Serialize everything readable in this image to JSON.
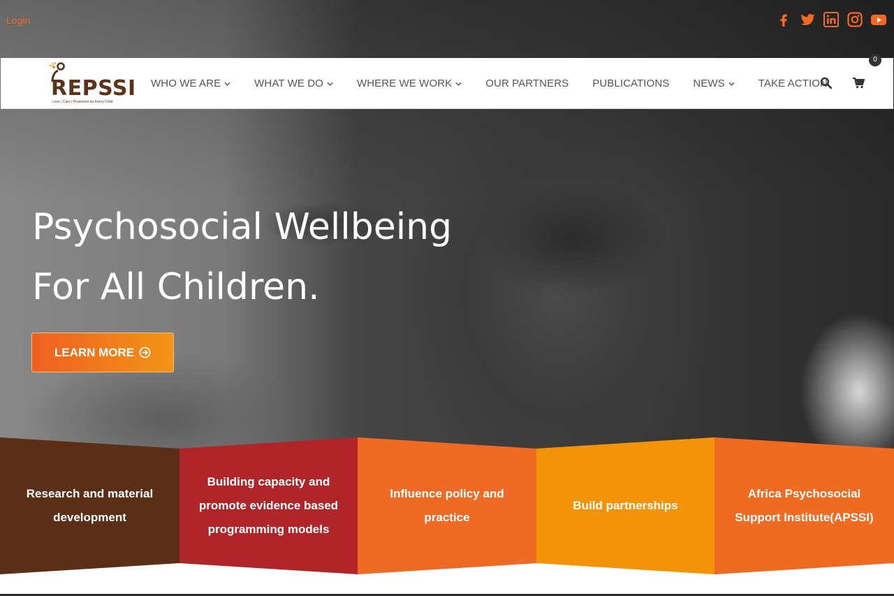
{
  "topbar": {
    "login_label": "Login",
    "socials": [
      "facebook-icon",
      "twitter-icon",
      "linkedin-icon",
      "instagram-icon",
      "youtube-icon"
    ]
  },
  "brand": {
    "name": "REPSSI",
    "tagline": "Love | Care | Protection for Every Child"
  },
  "nav": {
    "items": [
      {
        "label": "WHO WE ARE",
        "dropdown": true
      },
      {
        "label": "WHAT WE DO",
        "dropdown": true
      },
      {
        "label": "WHERE WE WORK",
        "dropdown": true
      },
      {
        "label": "OUR PARTNERS",
        "dropdown": false
      },
      {
        "label": "PUBLICATIONS",
        "dropdown": false
      },
      {
        "label": "NEWS",
        "dropdown": true
      },
      {
        "label": "TAKE ACTION",
        "dropdown": false
      }
    ],
    "cart_count": "0"
  },
  "hero": {
    "line1": "Psychosocial Wellbeing",
    "line2": "For All Children.",
    "cta_label": "LEARN MORE"
  },
  "pillars": [
    {
      "line1": "Research and material",
      "line2": "development",
      "line3": "",
      "color": "#5b2f17"
    },
    {
      "line1": "Building capacity and",
      "line2": "promote evidence based",
      "line3": "programming models",
      "color": "#b0252a"
    },
    {
      "line1": "Influence policy and",
      "line2": "practice",
      "line3": "",
      "color": "#ef6a25"
    },
    {
      "line1": "Build partnerships",
      "line2": "",
      "line3": "",
      "color": "#f39309"
    },
    {
      "line1": "Africa Psychosocial",
      "line2": "Support Institute(APSSI)",
      "line3": "",
      "color": "#f06b22"
    }
  ],
  "colors": {
    "accent": "#f26a22",
    "brand_brown": "#5b3318"
  }
}
